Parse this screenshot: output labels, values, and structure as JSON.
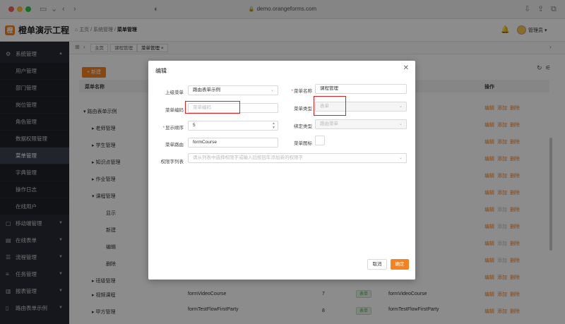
{
  "browser": {
    "url": "demo.orangeforms.com"
  },
  "header": {
    "title": "橙单演示工程",
    "logo": "橙",
    "breadcrumb": [
      "主页",
      "系统管理",
      "菜单管理"
    ],
    "user": "管理员"
  },
  "sidebar": {
    "system": "系统管理",
    "items": [
      "用户管理",
      "部门管理",
      "岗位管理",
      "角色管理",
      "数据权限管理",
      "菜单管理",
      "字典管理",
      "操作日志",
      "在线用户"
    ],
    "groups": [
      "移动端管理",
      "在线表单",
      "流程管理",
      "任务管理",
      "报表管理",
      "路由表单示例"
    ]
  },
  "tabs": [
    "主页",
    "课程管理",
    "菜单管理"
  ],
  "main": {
    "new_label": "+ 新建",
    "col_name": "菜单名称",
    "col_ops": "操作",
    "rows": [
      "路由表单示例",
      "老师管理",
      "学生管理",
      "知识点管理",
      "作业管理",
      "课程管理",
      "显示",
      "新建",
      "编辑",
      "删除",
      "班级管理",
      "视频课程",
      "甲方管理"
    ],
    "op_edit": "编辑",
    "op_add": "添加",
    "op_del": "删除",
    "video_route": "formVideoCourse",
    "video_order": "7",
    "party_route": "formTestFlowFirstParty",
    "party_order": "8",
    "badge": "表单"
  },
  "dialog": {
    "title": "编辑",
    "parent_label": "上级菜单",
    "parent_value": "路由表单示例",
    "name_label": "菜单名称",
    "name_value": "课程管理",
    "code_label": "菜单编码",
    "code_placeholder": "菜单编码",
    "type_label": "菜单类型",
    "type_value": "表单",
    "order_label": "显示顺序",
    "order_value": "5",
    "bind_label": "绑定类型",
    "bind_value": "路由菜单",
    "route_label": "菜单路由",
    "route_value": "formCourse",
    "icon_label": "菜单图标",
    "perm_label": "权限字列表",
    "perm_placeholder": "请从列表中选择权限字或输入后按回车添加新的权限字",
    "cancel": "取消",
    "ok": "确定"
  }
}
